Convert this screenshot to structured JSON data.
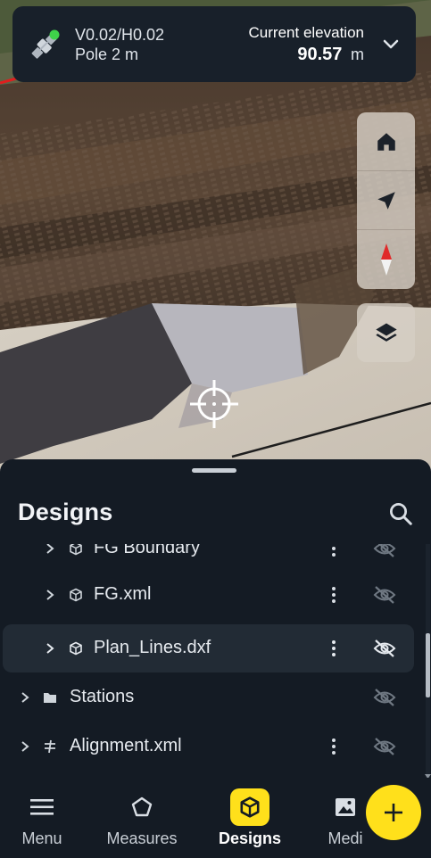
{
  "colors": {
    "accent": "#ffe01b",
    "panel": "#141b24",
    "selected_row": "#222b35",
    "boundary_line": "#e01e1e",
    "gnss_fix": "#3fd14a"
  },
  "gnss": {
    "accuracy": "V0.02/H0.02",
    "pole": "Pole 2 m",
    "elevation_label": "Current elevation",
    "elevation_value": "90.57",
    "elevation_unit": "m",
    "icon": "satellite-icon"
  },
  "map_controls": {
    "group1": [
      "home-icon",
      "navigation-arrow-icon",
      "compass-icon"
    ],
    "group2": [
      "layers-icon"
    ]
  },
  "sheet": {
    "title": "Designs",
    "search_icon": "search-icon"
  },
  "tree": [
    {
      "label": "FG Boundary",
      "type": "cube-icon",
      "level": 2,
      "menu": true,
      "visible": false,
      "selected": false
    },
    {
      "label": "FG.xml",
      "type": "cube-icon",
      "level": 2,
      "menu": true,
      "visible": false,
      "selected": false
    },
    {
      "label": "Plan_Lines.dxf",
      "type": "cube-icon",
      "level": 2,
      "menu": true,
      "visible": false,
      "selected": true
    },
    {
      "label": "Stations",
      "type": "folder-icon",
      "level": 1,
      "menu": false,
      "visible": false,
      "selected": false
    },
    {
      "label": "Alignment.xml",
      "type": "alignment-icon",
      "level": 1,
      "menu": true,
      "visible": false,
      "selected": false
    }
  ],
  "nav": {
    "items": [
      {
        "label": "Menu",
        "icon": "hamburger-icon",
        "active": false
      },
      {
        "label": "Measures",
        "icon": "polygon-icon",
        "active": false
      },
      {
        "label": "Designs",
        "icon": "design-cube-icon",
        "active": true
      },
      {
        "label": "Medi",
        "icon": "image-icon",
        "active": false
      }
    ],
    "fab_icon": "plus-icon"
  }
}
